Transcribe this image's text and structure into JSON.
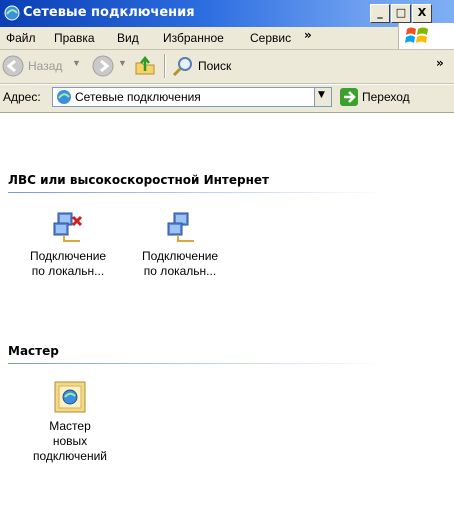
{
  "window": {
    "title": "Сетевые подключения",
    "buttons": {
      "minimize": "_",
      "maximize": "□",
      "close": "X"
    }
  },
  "menu": {
    "items": [
      {
        "label": "Файл"
      },
      {
        "label": "Правка"
      },
      {
        "label": "Вид"
      },
      {
        "label": "Избранное"
      },
      {
        "label": "Сервис"
      }
    ],
    "overflow": "»"
  },
  "toolbar": {
    "back_label": "Назад",
    "search_label": "Поиск",
    "overflow": "»"
  },
  "address": {
    "label": "Адрес:",
    "value": "Сетевые подключения",
    "go_label": "Переход"
  },
  "groups": [
    {
      "title": "ЛВС или высокоскоростной Интернет",
      "items": [
        {
          "line1": "Подключение",
          "line2": "по локальн...",
          "state": "disconnected"
        },
        {
          "line1": "Подключение",
          "line2": "по локальн...",
          "state": "connected"
        }
      ]
    },
    {
      "title": "Мастер",
      "items": [
        {
          "line1": "Мастер",
          "line2": "новых",
          "line3": "подключений"
        }
      ]
    }
  ],
  "colors": {
    "titlebar": "#0a3fb4",
    "chrome": "#ece9d8",
    "group_line": "#7a96df",
    "go_arrow": "#3aa02e"
  }
}
